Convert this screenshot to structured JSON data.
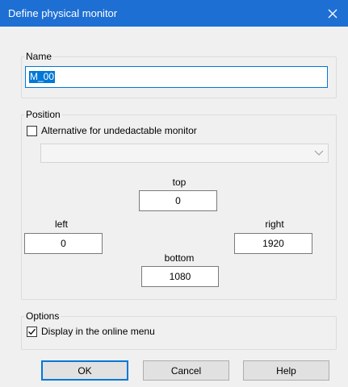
{
  "window": {
    "title": "Define physical monitor",
    "close_icon": "close-icon",
    "title_bar_color": "#1e6fd4"
  },
  "name_group": {
    "label": "Name",
    "value": "M_00"
  },
  "position_group": {
    "label": "Position",
    "alternative_checkbox": {
      "label": "Alternative for undedactable monitor",
      "checked": false
    },
    "monitor_dropdown": {
      "value": "",
      "enabled": false,
      "icon": "chevron-down-icon"
    },
    "top": {
      "label": "top",
      "value": "0"
    },
    "left": {
      "label": "left",
      "value": "0"
    },
    "right": {
      "label": "right",
      "value": "1920"
    },
    "bottom": {
      "label": "bottom",
      "value": "1080"
    }
  },
  "options_group": {
    "label": "Options",
    "display_online_menu": {
      "label": "Display in the online menu",
      "checked": true
    }
  },
  "buttons": {
    "ok": "OK",
    "cancel": "Cancel",
    "help": "Help"
  },
  "accent_color": "#0078d7"
}
